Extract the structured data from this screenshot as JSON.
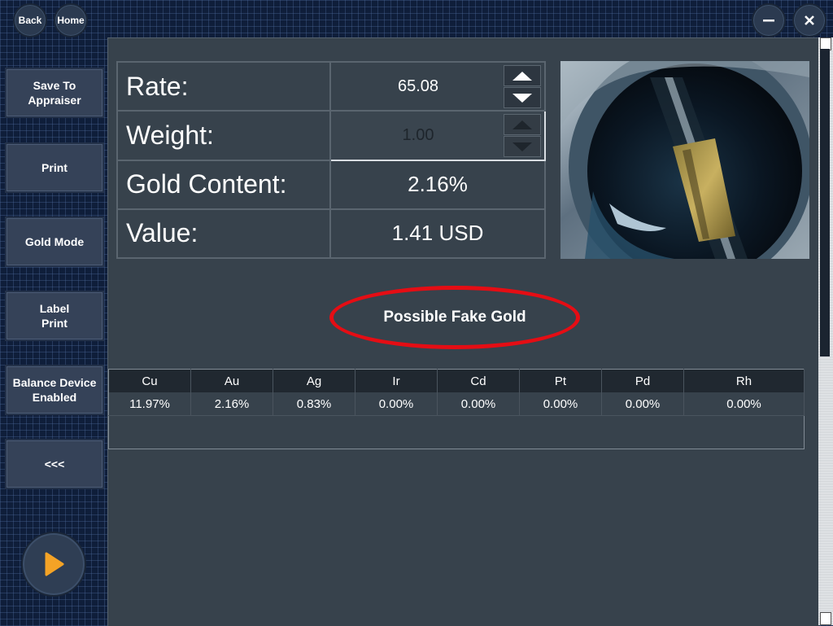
{
  "topbar": {
    "back_label": "Back",
    "home_label": "Home",
    "minimize_icon": "minimize-icon",
    "close_icon": "close-icon"
  },
  "sidebar": {
    "save_label": "Save To\nAppraiser",
    "print_label": "Print",
    "gold_mode_label": "Gold Mode",
    "label_print_label": "Label\nPrint",
    "balance_label": "Balance Device\nEnabled",
    "collapse_label": "<<<",
    "play_icon": "play-icon"
  },
  "info": {
    "rate_label": "Rate:",
    "rate_value": "65.08",
    "weight_label": "Weight:",
    "weight_value": "1.00",
    "gold_label": "Gold Content:",
    "gold_value": "2.16%",
    "value_label": "Value:",
    "value_value": "1.41 USD"
  },
  "status": {
    "message": "Possible Fake Gold",
    "highlight_color": "#e50d14"
  },
  "elements": {
    "headers": [
      "Cu",
      "Au",
      "Ag",
      "Ir",
      "Cd",
      "Pt",
      "Pd",
      "Rh"
    ],
    "values": [
      "11.97%",
      "2.16%",
      "0.83%",
      "0.00%",
      "0.00%",
      "0.00%",
      "0.00%",
      "0.00%"
    ]
  },
  "colors": {
    "play_accent": "#f4a326",
    "panel": "#37424c",
    "button": "#354258"
  }
}
